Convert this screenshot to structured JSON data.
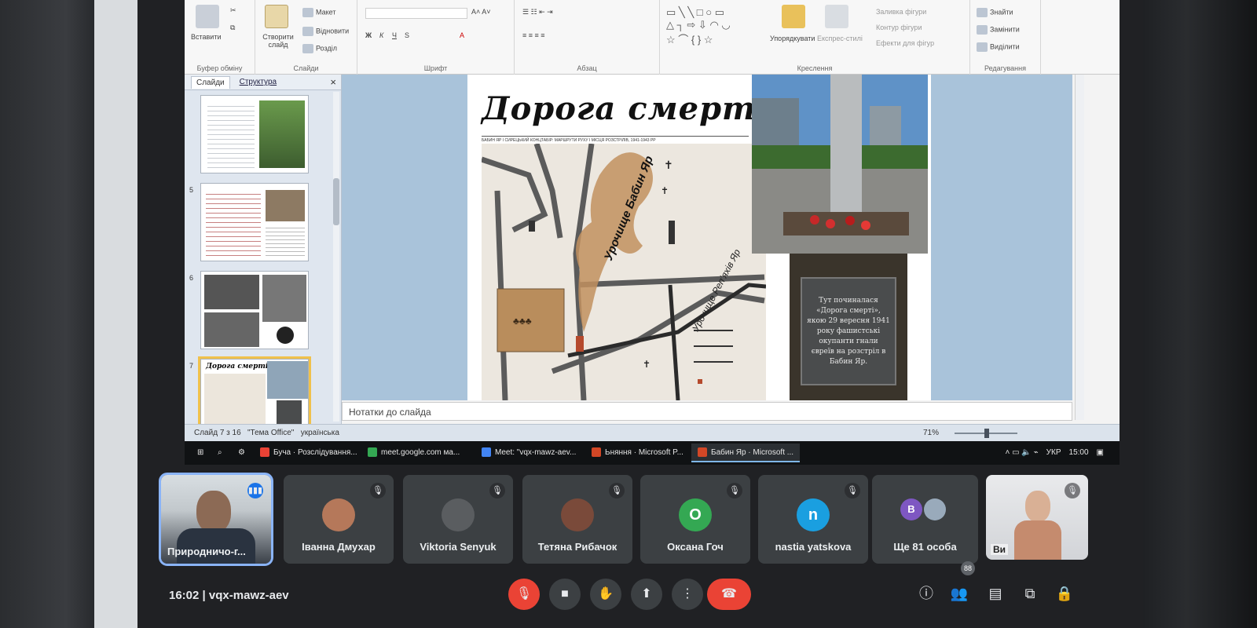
{
  "ribbon": {
    "clipboard_label": "Буфер обміну",
    "paste_label": "Вставити",
    "slides_group_label": "Слайди",
    "new_slide_label": "Створити слайд",
    "layout_label": "Макет",
    "reset_label": "Відновити",
    "section_label": "Розділ",
    "font_group_label": "Шрифт",
    "paragraph_group_label": "Абзац",
    "drawing_group_label": "Креслення",
    "arrange_label": "Упорядкувати",
    "quick_styles_label": "Експрес-стилі",
    "shape_fill_label": "Заливка фігури",
    "shape_outline_label": "Контур фігури",
    "shape_effects_label": "Ефекти для фігур",
    "editing_group_label": "Редагування",
    "find_label": "Знайти",
    "replace_label": "Замінити",
    "select_label": "Виділити"
  },
  "side_panel": {
    "tab_slides": "Слайди",
    "tab_outline": "Структура",
    "close": "×",
    "thumbnails": [
      {
        "num": "",
        "active": false
      },
      {
        "num": "5",
        "active": false
      },
      {
        "num": "6",
        "active": false
      },
      {
        "num": "7",
        "title": "Дорога смерті",
        "active": true
      }
    ]
  },
  "slide": {
    "title": "Дорога смерті",
    "map_caption": "БАБИН ЯР І СИРЕЦЬКИЙ КОНЦТАБІР: МАРШРУТИ РУХУ І МІСЦЯ РОЗСТРІЛІВ, 1941-1943 РР",
    "label_babyn_yar": "Урочище Бабин Яр",
    "label_repyakhiv_yar": "Урочище Реп'яхів Яр",
    "plaque_text": "Тут починалася «Дорога смерті», якою 29 вересня 1941 року фашистські окупанти гнали євреїв на розстріл в Бабин Яр."
  },
  "notes_placeholder": "Нотатки до слайда",
  "statusbar": {
    "slide_info": "Слайд 7 з 16",
    "theme": "\"Тема Office\"",
    "language": "українська",
    "zoom": "71%"
  },
  "taskbar": {
    "items": [
      {
        "label": "Буча · Розслідування...",
        "color": "#e94235",
        "active": false
      },
      {
        "label": "meet.google.com ма...",
        "color": "#34a853",
        "active": false
      },
      {
        "label": "Meet: \"vqx-mawz-aev...",
        "color": "#4285f4",
        "active": false
      },
      {
        "label": "Ьняння · Microsoft P...",
        "color": "#d24726",
        "active": false
      },
      {
        "label": "Бабин Яр · Microsoft ...",
        "color": "#d24726",
        "active": true
      }
    ],
    "tray_lang": "УКР",
    "tray_time": "15:00"
  },
  "participants": [
    {
      "name": "Природничо-г...",
      "type": "video",
      "speaking": true
    },
    {
      "name": "Іванна Дмухар",
      "type": "photo",
      "avatar_color": "#b5785a"
    },
    {
      "name": "Viktoria Senyuk",
      "type": "photo",
      "avatar_color": "#5a5d60"
    },
    {
      "name": "Тетяна Рибачок",
      "type": "photo",
      "avatar_color": "#7a4a3a"
    },
    {
      "name": "Оксана Гоч",
      "type": "letter",
      "letter": "О",
      "avatar_color": "#34a853"
    },
    {
      "name": "nastia yatskova",
      "type": "letter",
      "letter": "n",
      "avatar_color": "#1a9fe0"
    },
    {
      "name": "Ще 81 особа",
      "type": "group",
      "letter": "B",
      "avatar_color": "#7e57c2"
    },
    {
      "name": "Ви",
      "type": "self"
    }
  ],
  "meet": {
    "time": "16:02",
    "separator": "|",
    "code": "vqx-mawz-aev",
    "participant_count": "88"
  }
}
